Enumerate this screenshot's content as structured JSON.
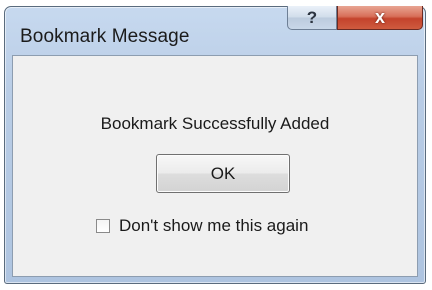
{
  "dialog": {
    "title": "Bookmark Message",
    "help_glyph": "?",
    "close_glyph": "x",
    "message": "Bookmark Successfully Added",
    "ok_label": "OK",
    "checkbox": {
      "label": "Don't show me this again",
      "checked": false
    }
  },
  "icons": {
    "help": "help-icon",
    "close": "close-icon"
  }
}
